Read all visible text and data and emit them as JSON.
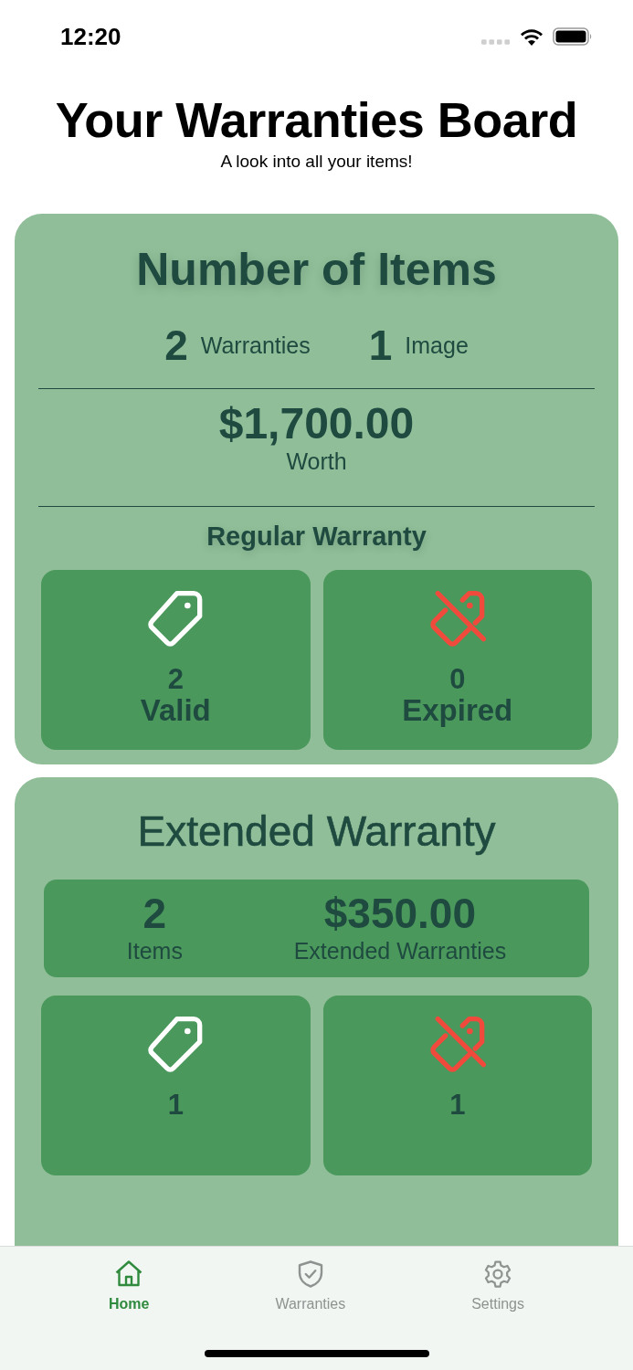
{
  "status_bar": {
    "time": "12:20"
  },
  "header": {
    "title": "Your Warranties Board",
    "subtitle": "A look into all your items!"
  },
  "summary_card": {
    "title": "Number of Items",
    "counts": [
      {
        "value": "2",
        "label": "Warranties"
      },
      {
        "value": "1",
        "label": "Image"
      }
    ],
    "worth": {
      "value": "$1,700.00",
      "label": "Worth"
    },
    "section_title": "Regular Warranty",
    "stats": [
      {
        "kind": "valid",
        "value": "2",
        "label": "Valid"
      },
      {
        "kind": "expired",
        "value": "0",
        "label": "Expired"
      }
    ]
  },
  "extended_card": {
    "title": "Extended Warranty",
    "totals": [
      {
        "value": "2",
        "label": "Items"
      },
      {
        "value": "$350.00",
        "label": "Extended Warranties"
      }
    ],
    "stats": [
      {
        "kind": "valid",
        "value": "1"
      },
      {
        "kind": "expired",
        "value": "1"
      }
    ]
  },
  "tab_bar": [
    {
      "kind": "home",
      "label": "Home",
      "selected": true
    },
    {
      "kind": "warranties",
      "label": "Warranties",
      "selected": false
    },
    {
      "kind": "settings",
      "label": "Settings",
      "selected": false
    }
  ]
}
